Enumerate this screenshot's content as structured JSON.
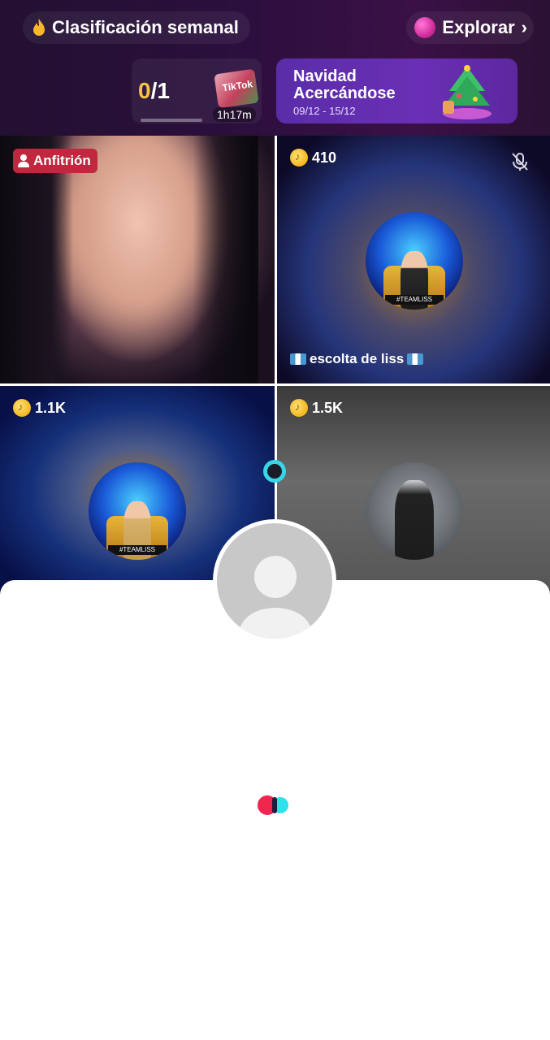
{
  "header": {
    "weekly_ranking_label": "Clasificación semanal",
    "explore_label": "Explorar",
    "progress": {
      "current": "0",
      "separator_total": "/1",
      "timer": "1h17m",
      "gift_label": "TikTok"
    },
    "event": {
      "title": "Navidad Acercándose",
      "dates": "09/12 - 15/12"
    }
  },
  "tiles": [
    {
      "role": "host",
      "badge": "Anfitrión"
    },
    {
      "coins": "410",
      "name": "escolta de liss",
      "muted": true,
      "avatar_tag": "#TEAMLISS"
    },
    {
      "coins": "1.1K",
      "avatar_tag": "#TEAMLISS"
    },
    {
      "coins": "1.5K"
    }
  ],
  "colors": {
    "accent_red": "#f0264e",
    "accent_cyan": "#2fe1ea",
    "host_badge": "#c0283f",
    "coin_gold": "#f3b51b"
  }
}
